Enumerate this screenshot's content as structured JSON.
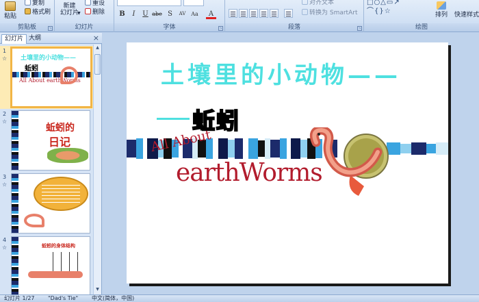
{
  "ribbon": {
    "clipboard": {
      "label": "剪贴板",
      "paste": "粘贴",
      "copy": "复制",
      "format_painter": "格式刷"
    },
    "slides": {
      "label": "幻灯片",
      "new_slide": "新建",
      "new_slide_2": "幻灯片",
      "reset": "重设",
      "delete": "删除"
    },
    "font": {
      "label": "字体",
      "bold": "B",
      "italic": "I",
      "underline": "U",
      "strike": "abe",
      "shadow": "S",
      "spacing": "AV",
      "case": "Aa",
      "color": "A"
    },
    "paragraph": {
      "label": "段落",
      "align_text": "对齐文本",
      "smartart": "转换为 SmartArt"
    },
    "drawing": {
      "label": "绘图",
      "arrange": "排列",
      "quick_styles": "快速样式"
    }
  },
  "panel": {
    "tab_slides": "幻灯片",
    "tab_outline": "大纲",
    "close": "×",
    "thumbs": [
      {
        "num": "1",
        "mark": "☆",
        "title": "土壤里的小动物——",
        "sub": "蚯蚓",
        "art": "All About earthWorms",
        "selected": true
      },
      {
        "num": "2",
        "mark": "☆",
        "title": "蚯蚓的",
        "sub": "日记"
      },
      {
        "num": "3",
        "mark": "☆",
        "title": ""
      },
      {
        "num": "4",
        "mark": "☆",
        "title": "蚯蚓的身体结构"
      }
    ]
  },
  "slide": {
    "title": "土壤里的小动物——",
    "subtitle": "蚯蚓",
    "art_line1": "All About",
    "art_line2": "earthWorms"
  },
  "status": {
    "slide_count": "幻灯片 1/27",
    "theme": "\"Dad's Tie\"",
    "language": "中文(简体，中国)"
  },
  "colors": {
    "title": "#4ee0e0",
    "art_red": "#b21c2d",
    "selection": "#f2b545"
  }
}
